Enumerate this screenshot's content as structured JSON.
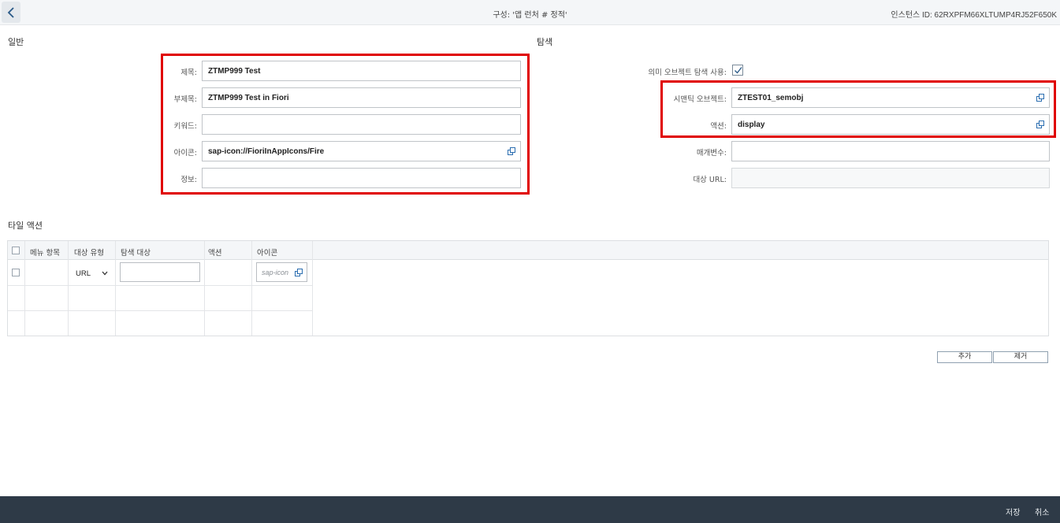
{
  "header": {
    "title": "구성: '앱 런처 # 정적'",
    "instance_id": "인스턴스 ID: 62RXPFM66XLTUMP4RJ52F650K"
  },
  "general": {
    "section_title": "일반",
    "fields": [
      {
        "label": "제목:",
        "value": "ZTMP999 Test"
      },
      {
        "label": "부제목:",
        "value": "ZTMP999 Test in Fiori"
      },
      {
        "label": "키워드:",
        "value": ""
      },
      {
        "label": "아이콘:",
        "value": "sap-icon://FioriInAppIcons/Fire"
      },
      {
        "label": "정보:",
        "value": ""
      }
    ]
  },
  "navigation": {
    "section_title": "탐색",
    "use_semantic_label": "의미 오브젝트 탐색 사용:",
    "use_semantic_checked": true,
    "fields": [
      {
        "label": "시맨틱 오브젝트:",
        "value": "ZTEST01_semobj"
      },
      {
        "label": "액션:",
        "value": "display"
      },
      {
        "label": "매개변수:",
        "value": ""
      },
      {
        "label": "대상 URL:",
        "value": ""
      }
    ]
  },
  "tile_actions": {
    "section_title": "타일 액션",
    "columns": [
      "메뉴 항목",
      "대상 유형",
      "탐색 대상",
      "액션",
      "아이콘"
    ],
    "rows": [
      {
        "target_type": "URL",
        "icon_placeholder": "sap-icon"
      }
    ],
    "add_label": "추가",
    "remove_label": "제거"
  },
  "footer": {
    "save_label": "저장",
    "cancel_label": "취소"
  },
  "icons": {
    "back": "chevron-left-icon",
    "value_help": "value-help-icon",
    "check": "checkmark-icon",
    "dropdown": "chevron-down-icon"
  },
  "colors": {
    "highlight": "#e00000",
    "footer_bg": "#2e3a47"
  }
}
